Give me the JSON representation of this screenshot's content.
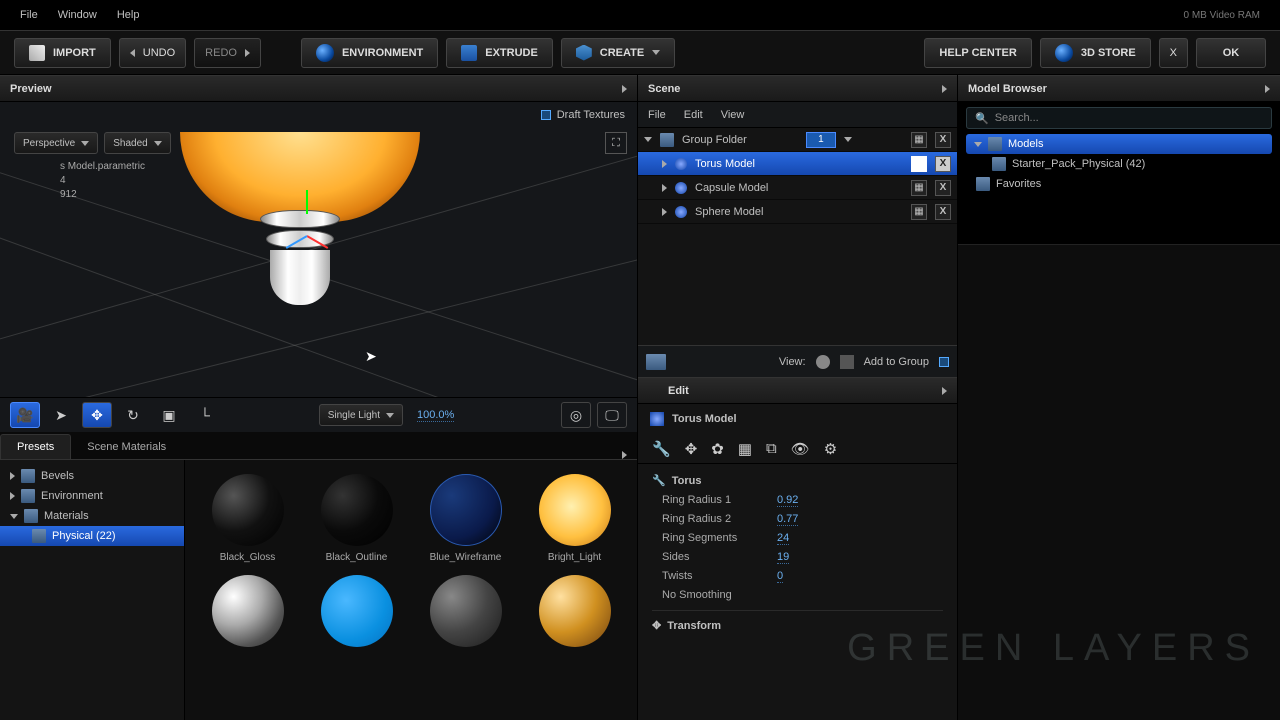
{
  "topbar": {
    "menu_file": "File",
    "menu_window": "Window",
    "menu_help": "Help",
    "vram": "0 MB Video RAM"
  },
  "ribbon": {
    "import": "IMPORT",
    "undo": "UNDO",
    "redo": "REDO",
    "environment": "ENVIRONMENT",
    "extrude": "EXTRUDE",
    "create": "CREATE",
    "help": "HELP CENTER",
    "store": "3D STORE",
    "close": "X",
    "ok": "OK"
  },
  "preview": {
    "title": "Preview",
    "draft": "Draft Textures",
    "persp": "Perspective",
    "shading": "Shaded",
    "info1": "s Model.parametric",
    "info2": "4",
    "info3": "912",
    "light": "Single Light",
    "pct": "100.0%"
  },
  "mtabs": {
    "presets": "Presets",
    "scenemat": "Scene Materials"
  },
  "mtree": {
    "bevels": "Bevels",
    "env": "Environment",
    "mats": "Materials",
    "phys": "Physical (22)"
  },
  "mats": {
    "m0": "Black_Gloss",
    "m1": "Black_Outline",
    "m2": "Blue_Wireframe",
    "m3": "Bright_Light"
  },
  "scene": {
    "title": "Scene",
    "file": "File",
    "edit": "Edit",
    "view": "View",
    "group": "Group Folder",
    "torus": "Torus Model",
    "capsule": "Capsule Model",
    "sphere": "Sphere Model",
    "viewlbl": "View:",
    "add": "Add to Group",
    "x": "X",
    "count": "1"
  },
  "edit": {
    "tab": "Edit",
    "title": "Torus Model",
    "sec": "Torus",
    "rr1": "Ring Radius 1",
    "rr1v": "0.92",
    "rr2": "Ring Radius 2",
    "rr2v": "0.77",
    "seg": "Ring Segments",
    "segv": "24",
    "sides": "Sides",
    "sidesv": "19",
    "tw": "Twists",
    "twv": "0",
    "nosm": "No Smoothing",
    "transform": "Transform"
  },
  "mb": {
    "title": "Model Browser",
    "ph": "Search...",
    "models": "Models",
    "pack": "Starter_Pack_Physical (42)",
    "fav": "Favorites"
  },
  "wm": "GREEN LAYERS"
}
